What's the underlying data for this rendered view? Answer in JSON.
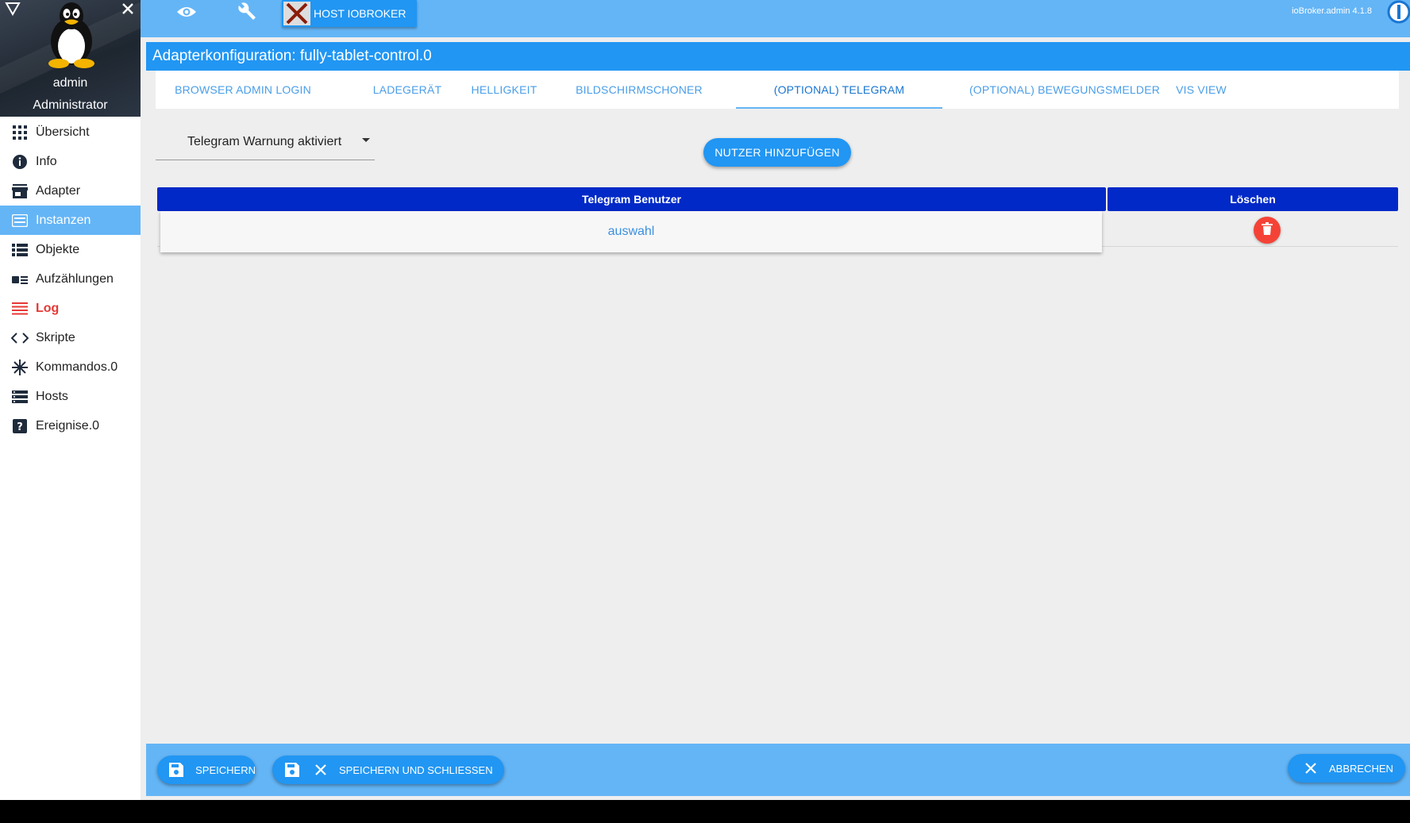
{
  "user": {
    "name": "admin",
    "role": "Administrator"
  },
  "nav": [
    {
      "id": "overview",
      "label": "Übersicht",
      "icon": "grid-icon"
    },
    {
      "id": "info",
      "label": "Info",
      "icon": "info-icon"
    },
    {
      "id": "adapter",
      "label": "Adapter",
      "icon": "store-icon"
    },
    {
      "id": "instances",
      "label": "Instanzen",
      "icon": "instances-icon",
      "active": true
    },
    {
      "id": "objects",
      "label": "Objekte",
      "icon": "list-icon"
    },
    {
      "id": "enums",
      "label": "Aufzählungen",
      "icon": "enum-icon"
    },
    {
      "id": "log",
      "label": "Log",
      "icon": "log-icon"
    },
    {
      "id": "scripts",
      "label": "Skripte",
      "icon": "code-icon"
    },
    {
      "id": "commands",
      "label": "Kommandos.0",
      "icon": "snowflake-icon"
    },
    {
      "id": "hosts",
      "label": "Hosts",
      "icon": "hosts-icon"
    },
    {
      "id": "events",
      "label": "Ereignise.0",
      "icon": "help-icon"
    }
  ],
  "topbar": {
    "host_label": "HOST IOBROKER",
    "version": "ioBroker.admin 4.1.8"
  },
  "config": {
    "title": "Adapterkonfiguration: fully-tablet-control.0",
    "tabs": [
      "BROWSER ADMIN LOGIN",
      "LADEGERÄT",
      "HELLIGKEIT",
      "BILDSCHIRMSCHONER",
      "(OPTIONAL) TELEGRAM",
      "(OPTIONAL) BEWEGUNGSMELDER",
      "VIS VIEW"
    ],
    "active_tab": "(OPTIONAL) TELEGRAM"
  },
  "telegram": {
    "select_value": "Telegram Warnung aktiviert",
    "add_user_label": "NUTZER HINZUFÜGEN",
    "table": {
      "headers": [
        "Telegram Benutzer",
        "Löschen"
      ],
      "rows": [
        {
          "user": "auswahl"
        }
      ]
    }
  },
  "bottom": {
    "save_label": "SPEICHERN",
    "save_close_label": "SPEICHERN UND SCHLIESSEN",
    "cancel_label": "ABBRECHEN"
  },
  "colors": {
    "primary": "#2196f3",
    "light": "#64b5f6",
    "header_dark": "#0029c7",
    "danger": "#f44336",
    "log": "#e53935"
  }
}
